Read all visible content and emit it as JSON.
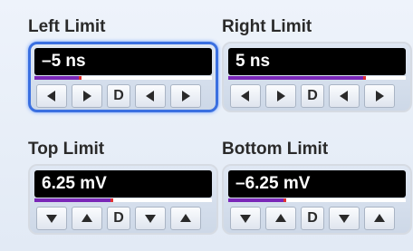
{
  "limits": [
    {
      "id": "left",
      "label": "Left Limit",
      "value": "–5 ns",
      "focused": true,
      "level": 0.26,
      "buttons": [
        "left-arrow-icon",
        "right-arrow-icon",
        "D",
        "left-arrow-icon",
        "right-arrow-icon"
      ]
    },
    {
      "id": "right",
      "label": "Right Limit",
      "value": "5 ns",
      "focused": false,
      "level": 0.77,
      "buttons": [
        "left-arrow-icon",
        "right-arrow-icon",
        "D",
        "left-arrow-icon",
        "right-arrow-icon"
      ]
    },
    {
      "id": "top",
      "label": "Top Limit",
      "value": "6.25 mV",
      "focused": false,
      "level": 0.44,
      "buttons": [
        "down-arrow-icon",
        "up-arrow-icon",
        "D",
        "down-arrow-icon",
        "up-arrow-icon"
      ]
    },
    {
      "id": "bottom",
      "label": "Bottom Limit",
      "value": "–6.25 mV",
      "focused": false,
      "level": 0.32,
      "buttons": [
        "down-arrow-icon",
        "up-arrow-icon",
        "D",
        "down-arrow-icon",
        "up-arrow-icon"
      ]
    }
  ],
  "colors": {
    "focus_border": "#3a6fe0",
    "level_fill": "#7a27b8",
    "level_marker": "#e03030",
    "value_background": "#000000",
    "value_text": "#ffffff"
  }
}
